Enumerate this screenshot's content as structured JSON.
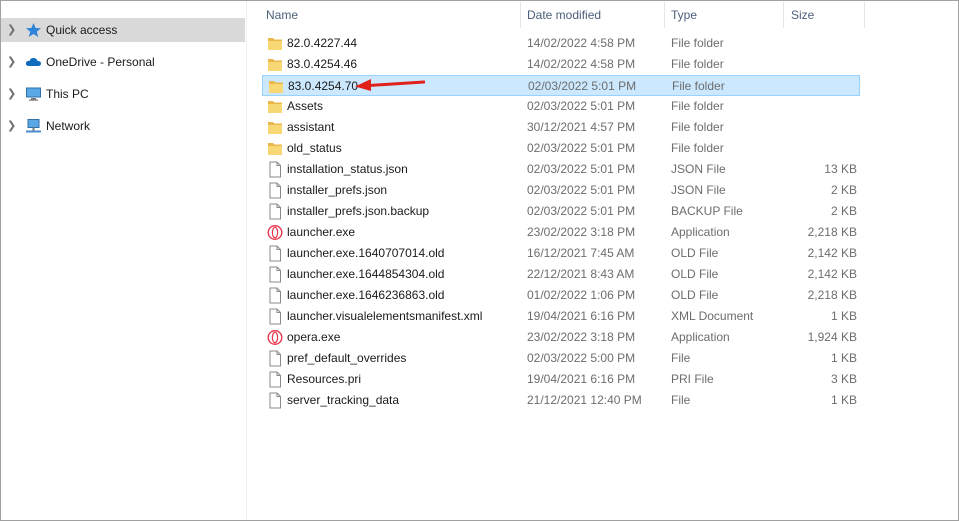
{
  "nav": {
    "items": [
      {
        "label": "Quick access",
        "icon": "star-icon",
        "selected": true
      },
      {
        "label": "OneDrive - Personal",
        "icon": "cloud-icon",
        "selected": false
      },
      {
        "label": "This PC",
        "icon": "computer-icon",
        "selected": false
      },
      {
        "label": "Network",
        "icon": "network-icon",
        "selected": false
      }
    ]
  },
  "columns": {
    "name": "Name",
    "date": "Date modified",
    "type": "Type",
    "size": "Size"
  },
  "files": [
    {
      "name": "82.0.4227.44",
      "date": "14/02/2022 4:58 PM",
      "type": "File folder",
      "size": "",
      "icon": "folder-icon"
    },
    {
      "name": "83.0.4254.46",
      "date": "14/02/2022 4:58 PM",
      "type": "File folder",
      "size": "",
      "icon": "folder-icon"
    },
    {
      "name": "83.0.4254.70",
      "date": "02/03/2022 5:01 PM",
      "type": "File folder",
      "size": "",
      "icon": "folder-icon",
      "selected": true
    },
    {
      "name": "Assets",
      "date": "02/03/2022 5:01 PM",
      "type": "File folder",
      "size": "",
      "icon": "folder-icon"
    },
    {
      "name": "assistant",
      "date": "30/12/2021 4:57 PM",
      "type": "File folder",
      "size": "",
      "icon": "folder-icon"
    },
    {
      "name": "old_status",
      "date": "02/03/2022 5:01 PM",
      "type": "File folder",
      "size": "",
      "icon": "folder-icon"
    },
    {
      "name": "installation_status.json",
      "date": "02/03/2022 5:01 PM",
      "type": "JSON File",
      "size": "13 KB",
      "icon": "file-icon"
    },
    {
      "name": "installer_prefs.json",
      "date": "02/03/2022 5:01 PM",
      "type": "JSON File",
      "size": "2 KB",
      "icon": "file-icon"
    },
    {
      "name": "installer_prefs.json.backup",
      "date": "02/03/2022 5:01 PM",
      "type": "BACKUP File",
      "size": "2 KB",
      "icon": "file-icon"
    },
    {
      "name": "launcher.exe",
      "date": "23/02/2022 3:18 PM",
      "type": "Application",
      "size": "2,218 KB",
      "icon": "opera-icon"
    },
    {
      "name": "launcher.exe.1640707014.old",
      "date": "16/12/2021 7:45 AM",
      "type": "OLD File",
      "size": "2,142 KB",
      "icon": "file-icon"
    },
    {
      "name": "launcher.exe.1644854304.old",
      "date": "22/12/2021 8:43 AM",
      "type": "OLD File",
      "size": "2,142 KB",
      "icon": "file-icon"
    },
    {
      "name": "launcher.exe.1646236863.old",
      "date": "01/02/2022 1:06 PM",
      "type": "OLD File",
      "size": "2,218 KB",
      "icon": "file-icon"
    },
    {
      "name": "launcher.visualelementsmanifest.xml",
      "date": "19/04/2021 6:16 PM",
      "type": "XML Document",
      "size": "1 KB",
      "icon": "file-icon"
    },
    {
      "name": "opera.exe",
      "date": "23/02/2022 3:18 PM",
      "type": "Application",
      "size": "1,924 KB",
      "icon": "opera-icon"
    },
    {
      "name": "pref_default_overrides",
      "date": "02/03/2022 5:00 PM",
      "type": "File",
      "size": "1 KB",
      "icon": "file-icon"
    },
    {
      "name": "Resources.pri",
      "date": "19/04/2021 6:16 PM",
      "type": "PRI File",
      "size": "3 KB",
      "icon": "file-icon"
    },
    {
      "name": "server_tracking_data",
      "date": "21/12/2021 12:40 PM",
      "type": "File",
      "size": "1 KB",
      "icon": "file-icon"
    }
  ],
  "colors": {
    "selection_bg": "#cce8ff",
    "selection_border": "#99d1ff",
    "nav_selected_bg": "#d9d9d9",
    "header_text": "#4c607a",
    "folder": "#f8d775",
    "annotation_arrow": "#e0201b"
  }
}
